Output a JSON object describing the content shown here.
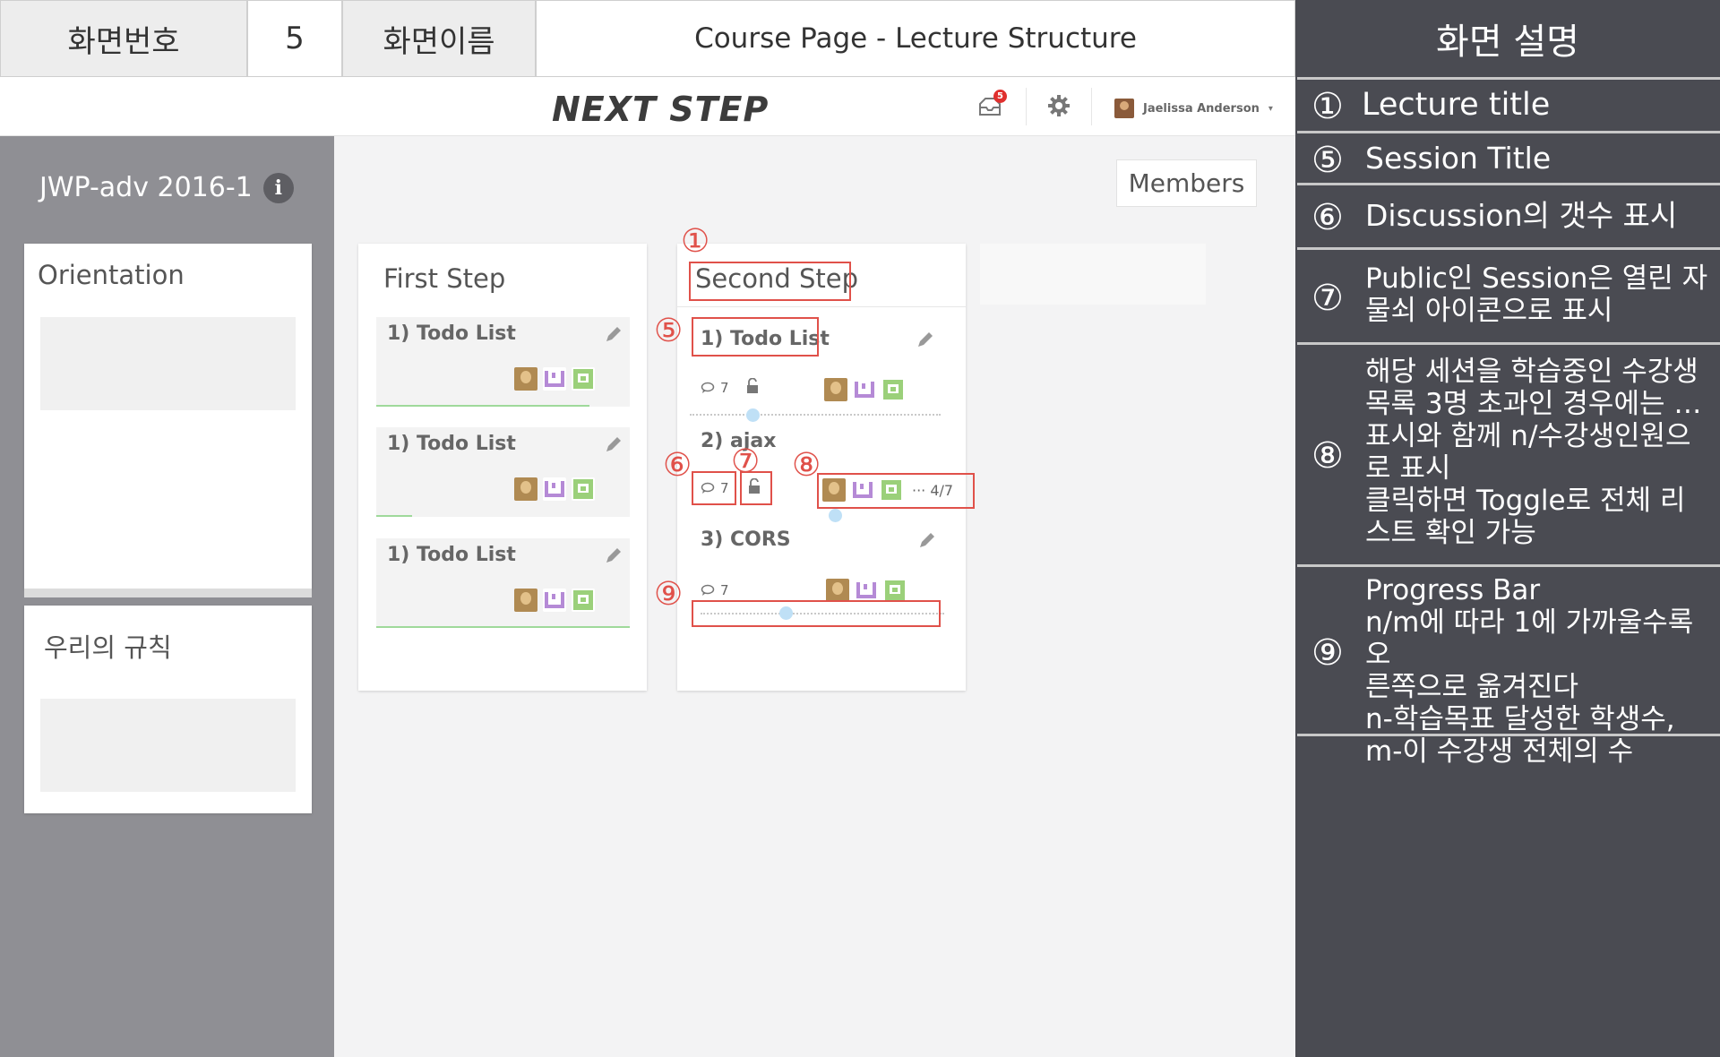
{
  "spec": {
    "screen_no_label": "화면번호",
    "screen_no_value": "5",
    "screen_name_label": "화면이름",
    "screen_name_value": "Course Page - Lecture Structure"
  },
  "navbar": {
    "logo": "NEXT STEP",
    "noti_count": "5",
    "user_name": "Jaelissa Anderson",
    "caret": "▾"
  },
  "sidebar": {
    "course_title": "JWP-adv 2016-1",
    "info_glyph": "i",
    "cards": [
      {
        "title": "Orientation"
      },
      {
        "title": "우리의 규칙"
      }
    ]
  },
  "main": {
    "members_label": "Members",
    "first_lecture": {
      "title": "First Step",
      "sessions": [
        {
          "title": "1) Todo List",
          "progress_fraction": 0.84
        },
        {
          "title": "1) Todo List",
          "progress_fraction": 0.14
        },
        {
          "title": "1) Todo List",
          "progress_fraction": 1.0
        }
      ]
    },
    "second_lecture": {
      "title": "Second Step",
      "sessions": [
        {
          "title": "1) Todo List",
          "discussions": "7",
          "progress_fraction": 0.25
        },
        {
          "title": "2) ajax",
          "discussions": "7",
          "student_count": "··· 4/7",
          "progress_fraction": 0.58
        },
        {
          "title": "3) CORS",
          "discussions": "7",
          "progress_fraction": 0.35
        }
      ]
    }
  },
  "markers": {
    "m1": "①",
    "m5": "⑤",
    "m6": "⑥",
    "m7": "⑦",
    "m8": "⑧",
    "m9": "⑨"
  },
  "description": {
    "title": "화면 설명",
    "items": [
      {
        "num": "①",
        "text": " Lecture title"
      },
      {
        "num": "⑤",
        "text": "Session Title"
      },
      {
        "num": "⑥",
        "text": "Discussion의 갯수 표시"
      },
      {
        "num": "⑦",
        "text": "Public인 Session은 열린 자\n물쇠 아이콘으로 표시"
      },
      {
        "num": "⑧",
        "text": "해당 세션을 학습중인 수강생\n목록 3명 초과인 경우에는 …\n표시와 함께 n/수강생인원으\n로 표시\n클릭하면 Toggle로 전체 리\n스트 확인 가능"
      },
      {
        "num": "⑨",
        "text": "Progress Bar\nn/m에 따라 1에 가까울수록 오\n른쪽으로 옮겨진다\nn-학습목표 달성한 학생수,\nm-이 수강생 전체의 수"
      }
    ]
  }
}
